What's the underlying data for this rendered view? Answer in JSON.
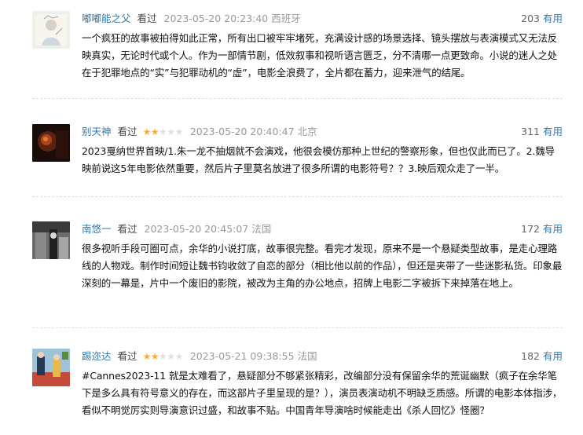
{
  "reviews": [
    {
      "user": "嘟嘟能之父",
      "seen_label": "看过",
      "rating": 0,
      "time": "2023-05-20 20:23:40",
      "location": "西班牙",
      "votes": "203",
      "useful_label": "有用",
      "content": "一个疯狂的故事被拍得如此正常，所有出口被牢牢堵死，充满设计感的场景选择、镜头摆放与表演模式又无法反映真实，无论时代或个人。作为一部情节剧，低效叙事和视听语言匮乏，分不清哪一点更致命。小说的迷人之处在于犯罪地点的“实”与犯罪动机的“虚”，电影全浪费了，全片都在蓄力，迎来泄气的结尾。"
    },
    {
      "user": "别天神",
      "seen_label": "看过",
      "rating": 2,
      "time": "2023-05-20 20:40:47",
      "location": "北京",
      "votes": "311",
      "useful_label": "有用",
      "content": "2023戛纳世界首映/1.朱一龙不抽烟就不会演戏，他很会模仿那种上世纪的警察形象，但也仅此而已了。2.魏导映前说这5年电影依然重要，然后片子里莫名放进了很多所谓的电影符号？？3.映后观众走了一半。"
    },
    {
      "user": "南悠一",
      "seen_label": "看过",
      "rating": 0,
      "time": "2023-05-20 20:45:07",
      "location": "法国",
      "votes": "172",
      "useful_label": "有用",
      "content": "很多视听手段可圈可点，余华的小说打底，故事很完整。看完才发现，原来不是一个悬疑类型故事，是走心理路线的人物戏。制作时间短让魏书钧收敛了自恋的部分（相比他以前的作品），但还是夹带了一些迷影私货。印象最深刻的一幕是，片中一个废旧的影院，被改为主角的办公地点，招牌上电影二字被拆下来掉落在地上。"
    },
    {
      "user": "踢迩达",
      "seen_label": "看过",
      "rating": 2,
      "time": "2023-05-21 09:38:55",
      "location": "法国",
      "votes": "182",
      "useful_label": "有用",
      "content": "#Cannes2023-11 就是太难看了，悬疑部分不够紧张精彩，改编部分没有保留余华的荒诞幽默（疯子在余华笔下是多么具有符号意义的存在，而这部片子里呈现的是？），演员表演动机不明缺乏质感。所谓的电影本体指涉，看似不明觉厉实则导演意识过盛，和故事不贴。中国青年导演啥时候能走出《杀人回忆》怪圈？"
    }
  ]
}
